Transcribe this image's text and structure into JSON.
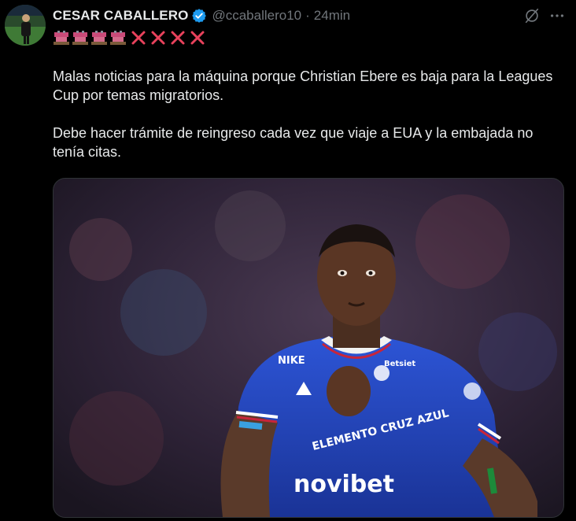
{
  "author": {
    "name": "CESAR CABALLERO",
    "handle": "@ccaballero10",
    "separator": "·",
    "timestamp": "24min",
    "verified": true,
    "verified_color": "#1d9bf0"
  },
  "bio_emojis": {
    "cups": [
      "cup-emoji",
      "cup-emoji",
      "cup-emoji",
      "cup-emoji"
    ],
    "x_marks": [
      "x-mark",
      "x-mark",
      "x-mark",
      "x-mark"
    ],
    "x_color": "#e8425c"
  },
  "tweet": {
    "paragraph_1": "Malas noticias para la máquina porque Christian Ebere es baja para la Leagues Cup por temas migratorios.",
    "paragraph_2": "Debe hacer trámite de reingreso cada vez que viaje a EUA y la embajada no tenía citas."
  },
  "media": {
    "jersey_text": {
      "sponsor_1": "NIKE",
      "sponsor_2": "Betsiet",
      "sleeve": "ELEMENTO CRUZ AZUL",
      "front": "novibet"
    },
    "jersey_color": "#2447b8"
  },
  "icons": {
    "grok": "grok-icon",
    "more": "more-icon",
    "verified": "verified-badge-icon"
  }
}
